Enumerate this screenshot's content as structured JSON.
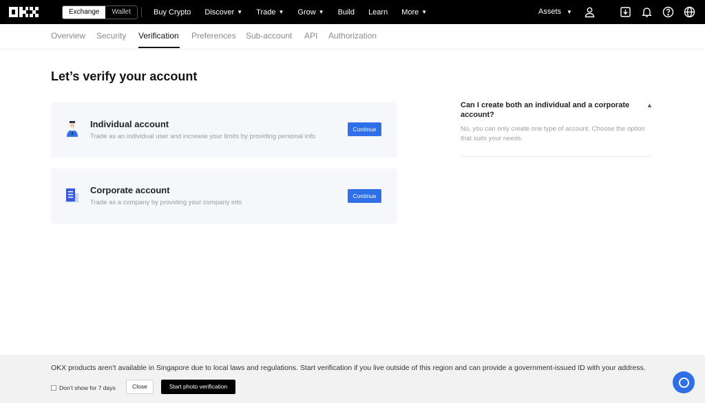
{
  "colors": {
    "accent": "#2f6fe8",
    "topbar": "#000000",
    "card_bg": "#f5f7fa",
    "banner_bg": "#f2f2f2"
  },
  "topnav": {
    "logo": "OKX",
    "toggle": {
      "exchange": "Exchange",
      "wallet": "Wallet"
    },
    "links": [
      {
        "label": "Buy Crypto",
        "dropdown": false
      },
      {
        "label": "Discover",
        "dropdown": true
      },
      {
        "label": "Trade",
        "dropdown": true
      },
      {
        "label": "Grow",
        "dropdown": true
      },
      {
        "label": "Build",
        "dropdown": false
      },
      {
        "label": "Learn",
        "dropdown": false
      },
      {
        "label": "More",
        "dropdown": true
      }
    ],
    "assets": "Assets",
    "icons": [
      "user-icon",
      "download-icon",
      "bell-icon",
      "help-icon",
      "globe-icon"
    ]
  },
  "subnav": {
    "tabs": [
      "Overview",
      "Security",
      "Verification",
      "Preferences",
      "Sub-account",
      "API",
      "Authorization"
    ],
    "active": "Verification"
  },
  "main": {
    "title": "Let’s verify your account",
    "cards": [
      {
        "title": "Individual account",
        "desc": "Trade as an individual user and increase your limits by providing personal info",
        "button": "Continue",
        "icon": "person-icon"
      },
      {
        "title": "Corporate account",
        "desc": "Trade as a company by providing your company info",
        "button": "Continue",
        "icon": "building-icon"
      }
    ]
  },
  "faq": {
    "question": "Can I create both an individual and a corporate account?",
    "answer": "No, you can only create one type of account. Choose the option that suits your needs."
  },
  "banner": {
    "message": "OKX products aren’t available in Singapore due to local laws and regulations. Start verification if you live outside of this region and can provide a government-issued ID with your address.",
    "checkbox_label": "Don’t show for 7 days",
    "close_label": "Close",
    "start_label": "Start photo verification"
  }
}
